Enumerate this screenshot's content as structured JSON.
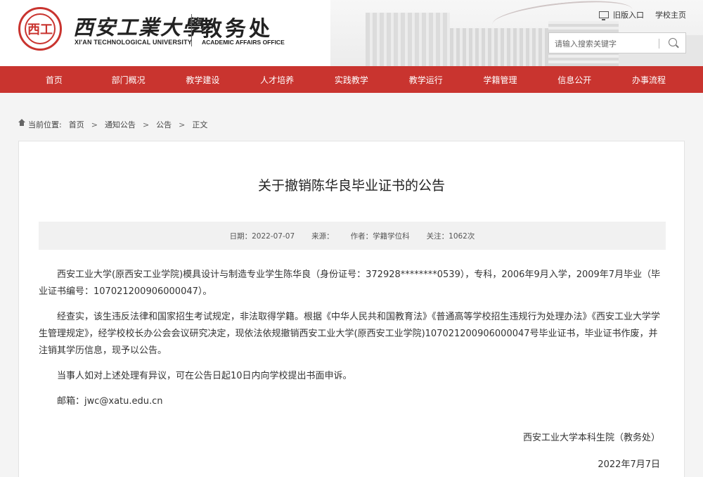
{
  "header": {
    "logo_seal_text": "西工",
    "logo_cn": "西安工業大學",
    "logo_en": "XI'AN TECHNOLOGICAL UNIVERSITY",
    "dept_cn": "教务处",
    "dept_en": "ACADEMIC AFFAIRS OFFICE",
    "old_version_link": "旧版入口",
    "homepage_link": "学校主页",
    "search_placeholder": "请输入搜索关键字"
  },
  "nav": {
    "items": [
      "首页",
      "部门概况",
      "教学建设",
      "人才培养",
      "实践教学",
      "教学运行",
      "学籍管理",
      "信息公开",
      "办事流程"
    ]
  },
  "breadcrumb": {
    "prefix": "当前位置:",
    "items": [
      "首页",
      "通知公告",
      "公告",
      "正文"
    ],
    "separator": ">"
  },
  "article": {
    "title": "关于撤销陈华良毕业证书的公告",
    "meta": {
      "date": "日期：2022-07-07",
      "source": "来源：",
      "author": "作者：学籍学位科",
      "views": "关注：1062次"
    },
    "paragraphs": [
      "西安工业大学(原西安工业学院)模具设计与制造专业学生陈华良（身份证号：372928********0539），专科，2006年9月入学，2009年7月毕业（毕业证书编号：107021200906000047）。",
      "经查实，该生违反法律和国家招生考试规定，非法取得学籍。根据《中华人民共和国教育法》《普通高等学校招生违规行为处理办法》《西安工业大学学生管理规定》，经学校校长办公会会议研究决定，现依法依规撤销西安工业大学(原西安工业学院)107021200906000047号毕业证书，毕业证书作废，并注销其学历信息，现予以公告。",
      "当事人如对上述处理有异议，可在公告日起10日内向学校提出书面申诉。",
      "邮箱：jwc@xatu.edu.cn"
    ],
    "signature": "西安工业大学本科生院（教务处）",
    "sign_date": "2022年7月7日"
  },
  "colors": {
    "accent": "#c9342f"
  }
}
